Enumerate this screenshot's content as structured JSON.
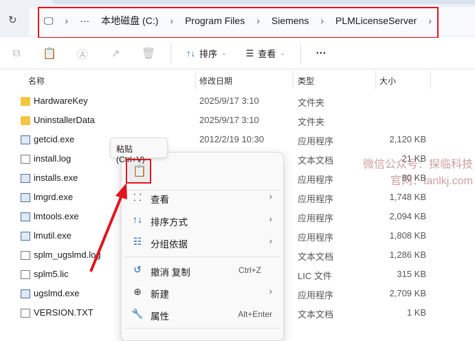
{
  "breadcrumb": {
    "items": [
      "本地磁盘 (C:)",
      "Program Files",
      "Siemens",
      "PLMLicenseServer"
    ],
    "overflow": "···"
  },
  "toolbar": {
    "sort_label": "排序",
    "view_label": "查看",
    "more": "···"
  },
  "columns": [
    "名称",
    "修改日期",
    "类型",
    "大小"
  ],
  "files": [
    {
      "name": "HardwareKey",
      "date": "2025/9/17 3:10",
      "type": "文件夹",
      "size": "",
      "kind": "folder"
    },
    {
      "name": "UninstallerData",
      "date": "2025/9/17 3:10",
      "type": "文件夹",
      "size": "",
      "kind": "folder"
    },
    {
      "name": "getcid.exe",
      "date": "2012/2/19 10:30",
      "type": "应用程序",
      "size": "2,120 KB",
      "kind": "exe"
    },
    {
      "name": "install.log",
      "date": "",
      "type": "文本文档",
      "size": "21 KB",
      "kind": "txt"
    },
    {
      "name": "installs.exe",
      "date": "",
      "type": "应用程序",
      "size": "80 KB",
      "kind": "exe"
    },
    {
      "name": "lmgrd.exe",
      "date": "",
      "type": "应用程序",
      "size": "1,748 KB",
      "kind": "exe"
    },
    {
      "name": "lmtools.exe",
      "date": "",
      "type": "应用程序",
      "size": "2,094 KB",
      "kind": "exe"
    },
    {
      "name": "lmutil.exe",
      "date": "",
      "type": "应用程序",
      "size": "1,808 KB",
      "kind": "exe"
    },
    {
      "name": "splm_ugslmd.log",
      "date": "",
      "type": "文本文档",
      "size": "1,286 KB",
      "kind": "txt"
    },
    {
      "name": "splm5.lic",
      "date": "",
      "type": "LIC 文件",
      "size": "315 KB",
      "kind": "txt"
    },
    {
      "name": "ugslmd.exe",
      "date": "",
      "type": "应用程序",
      "size": "2,709 KB",
      "kind": "exe"
    },
    {
      "name": "VERSION.TXT",
      "date": "",
      "type": "文本文档",
      "size": "1 KB",
      "kind": "txt"
    }
  ],
  "tooltip": "粘贴 (Ctrl+V)",
  "context_menu": {
    "items": [
      {
        "label": "查看",
        "icon": "grid-icon",
        "submenu": true
      },
      {
        "label": "排序方式",
        "icon": "sort-icon",
        "submenu": true
      },
      {
        "label": "分组依据",
        "icon": "group-icon",
        "submenu": true
      },
      {
        "label": "撤消 复制",
        "icon": "undo-icon",
        "shortcut": "Ctrl+Z"
      },
      {
        "label": "新建",
        "icon": "new-icon",
        "submenu": true
      },
      {
        "label": "属性",
        "icon": "wrench-icon",
        "shortcut": "Alt+Enter"
      }
    ]
  },
  "watermark": {
    "line1": "微信公众号：探临科技",
    "line2": "官网：tanlkj.com"
  }
}
